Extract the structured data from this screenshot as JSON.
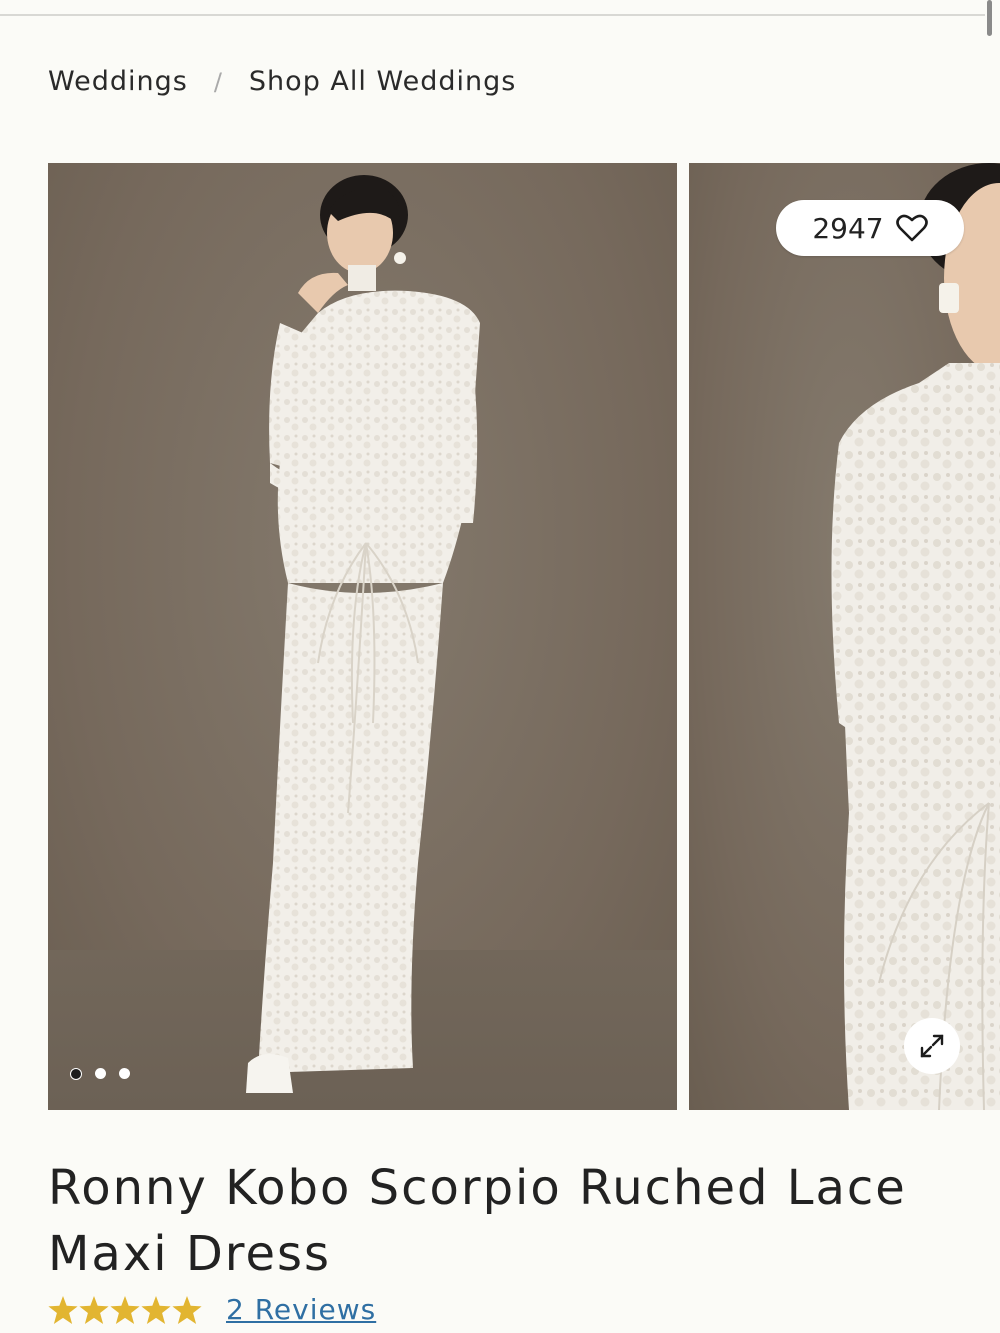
{
  "breadcrumb": {
    "items": [
      "Weddings",
      "Shop All Weddings"
    ],
    "separator": "/"
  },
  "gallery": {
    "slides": [
      "model-front",
      "model-closeup"
    ],
    "dots": 3,
    "active_dot": 0,
    "favorite_count": "2947",
    "favorite_icon": "heart-icon",
    "expand_icon": "expand-icon"
  },
  "product": {
    "title_line1": "Ronny Kobo Scorpio Ruched Lace",
    "title_line2": "Maxi Dress",
    "rating": 5,
    "rating_max": 5,
    "reviews_label": "2 Reviews"
  },
  "colors": {
    "background": "#fbfbf7",
    "star": "#e2b531",
    "link": "#2f6fa3",
    "photo_backdrop": "#7c7265"
  }
}
